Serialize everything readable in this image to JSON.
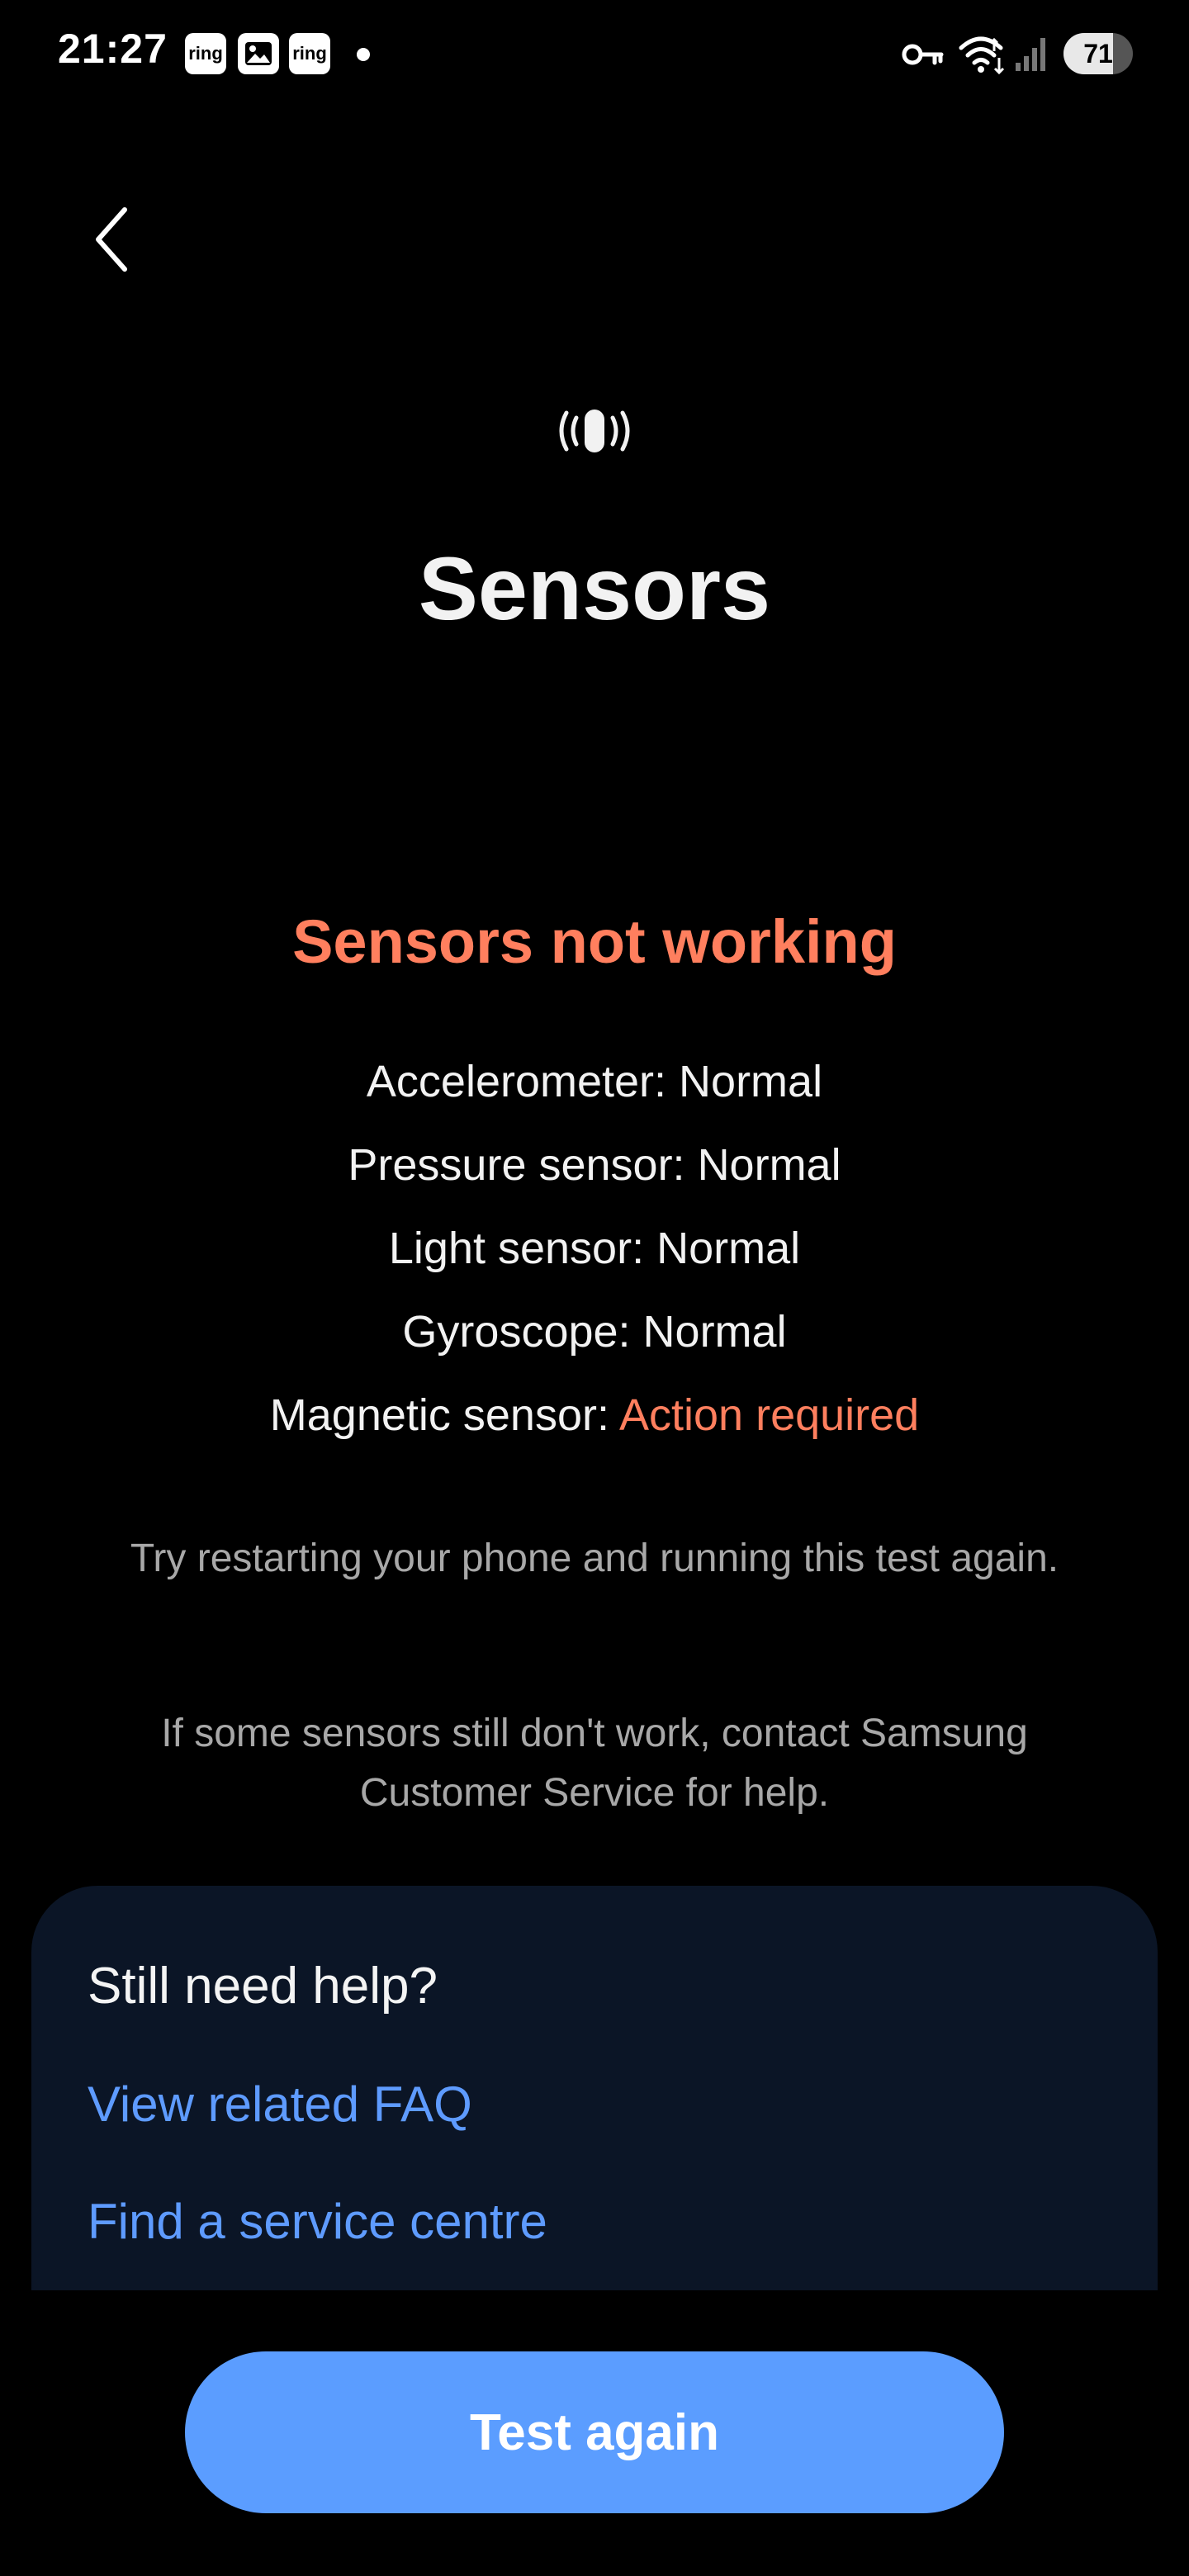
{
  "status_bar": {
    "time": "21:27",
    "notifications": [
      {
        "label": "ring"
      },
      {
        "icon": "gallery-icon"
      },
      {
        "label": "ring"
      }
    ],
    "battery_level": "71",
    "battery_fraction": 0.71
  },
  "header": {
    "back_icon": "chevron-left-icon",
    "sensor_icon": "vibration-icon",
    "title": "Sensors"
  },
  "result": {
    "status": "Sensors not working",
    "status_color": "#ff7f5e",
    "sensors": [
      {
        "name": "Accelerometer: ",
        "status": "Normal",
        "ok": true
      },
      {
        "name": "Pressure sensor: ",
        "status": "Normal",
        "ok": true
      },
      {
        "name": "Light sensor: ",
        "status": "Normal",
        "ok": true
      },
      {
        "name": "Gyroscope: ",
        "status": "Normal",
        "ok": true
      },
      {
        "name": "Magnetic sensor: ",
        "status": "Action required",
        "ok": false
      }
    ],
    "hint_restart": "Try restarting your phone and running this test again.",
    "hint_contact": "If some sensors still don't work, contact Samsung Customer Service for help."
  },
  "help": {
    "title": "Still need help?",
    "faq_link": "View related FAQ",
    "service_link": "Find a service centre",
    "link_color": "#5e9bff"
  },
  "actions": {
    "test_again": "Test again",
    "button_color": "#5b9dff"
  }
}
